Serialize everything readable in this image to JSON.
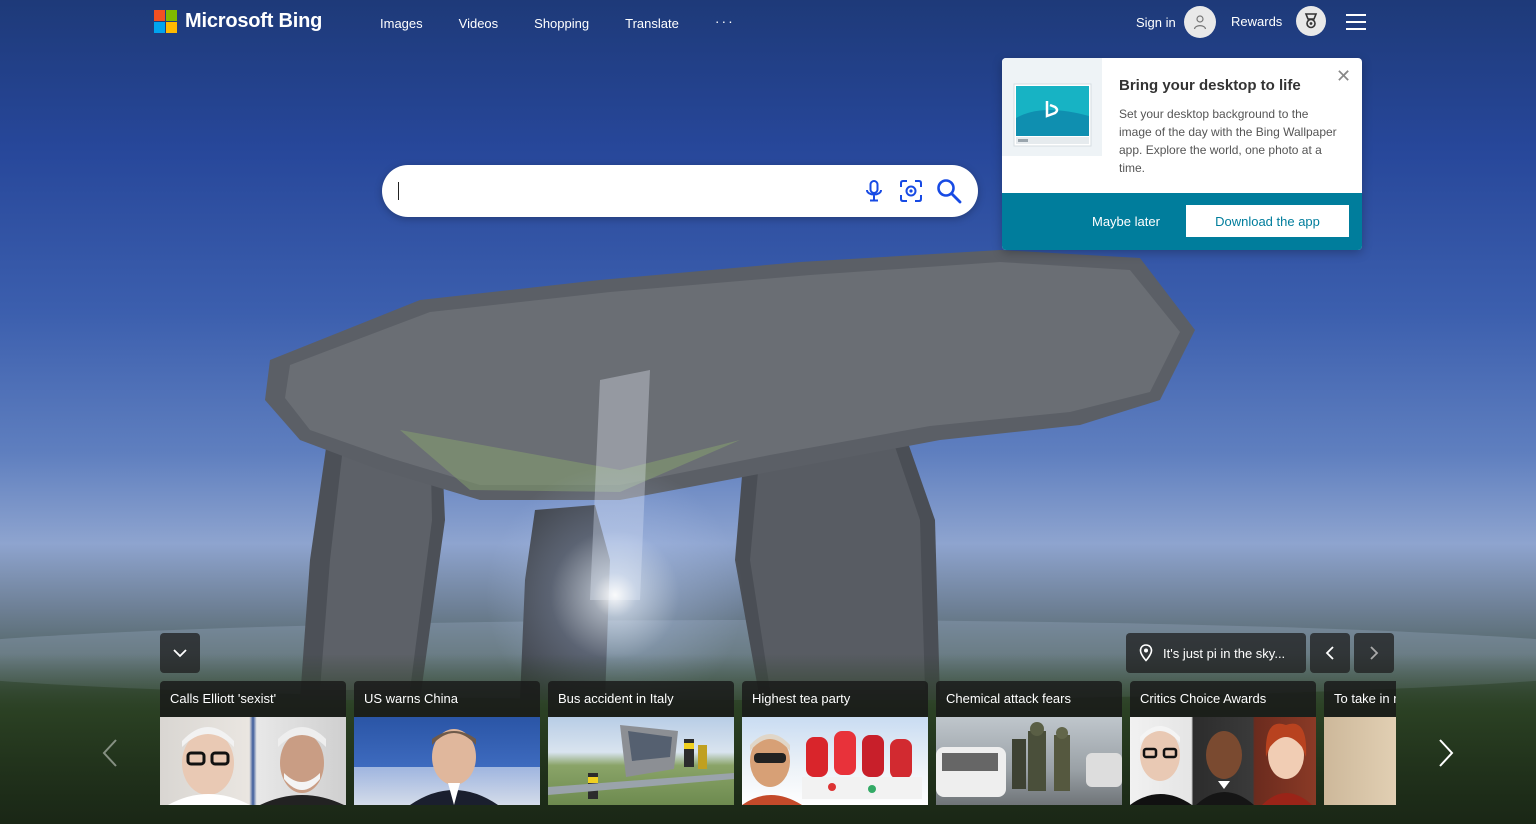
{
  "brand": {
    "name": "Microsoft Bing",
    "logo_colors": [
      "#f25022",
      "#7fba00",
      "#00a4ef",
      "#ffb900"
    ]
  },
  "nav": {
    "items": [
      "Images",
      "Videos",
      "Shopping",
      "Translate",
      "···"
    ]
  },
  "header": {
    "signin_label": "Sign in",
    "rewards_label": "Rewards",
    "menu_icon": "hamburger-icon"
  },
  "search": {
    "value": "",
    "placeholder": "",
    "icons": [
      "microphone-icon",
      "visual-search-icon",
      "search-icon"
    ]
  },
  "popup": {
    "title": "Bring your desktop to life",
    "text": "Set your desktop background to the image of the day with the Bing Wallpaper app. Explore the world, one photo at a time.",
    "close": "✕",
    "secondary_action": "Maybe later",
    "primary_action": "Download the app",
    "accent_color": "#007d9c"
  },
  "image_info": {
    "caption": "It's just pi in the sky..."
  },
  "news": {
    "cards": [
      {
        "title": "Calls Elliott 'sexist'"
      },
      {
        "title": "US warns China"
      },
      {
        "title": "Bus accident in Italy"
      },
      {
        "title": "Highest tea party"
      },
      {
        "title": "Chemical attack fears"
      },
      {
        "title": "Critics Choice Awards"
      },
      {
        "title": "To take in r"
      }
    ]
  }
}
